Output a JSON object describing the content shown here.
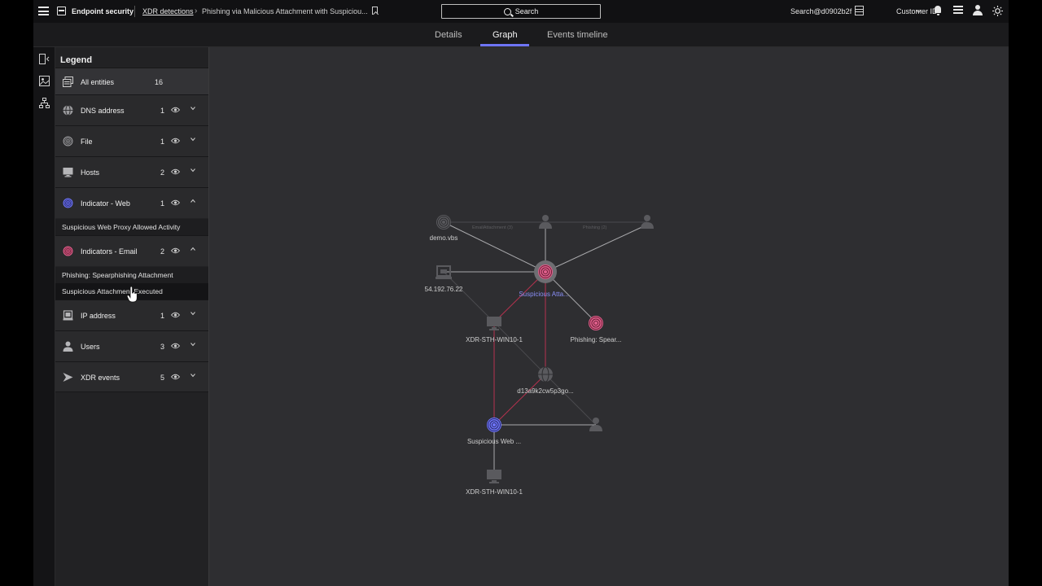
{
  "topbar": {
    "app_name": "Endpoint security",
    "breadcrumb_link": "XDR detections",
    "breadcrumb_current": "Phishing via Malicious Attachment with Suspiciou...",
    "search_label": "Search",
    "user_search": "Search@d0902b2f",
    "customer_label": "Customer ID"
  },
  "tabs": [
    {
      "label": "Details",
      "active": false
    },
    {
      "label": "Graph",
      "active": true
    },
    {
      "label": "Events timeline",
      "active": false
    }
  ],
  "accent_color": "#6e75f8",
  "legend": {
    "title": "Legend",
    "all_entities": {
      "label": "All entities",
      "count": "16"
    },
    "rows": [
      {
        "label": "DNS address",
        "count": "1",
        "icon": "globe-icon",
        "expanded": false
      },
      {
        "label": "File",
        "count": "1",
        "icon": "fingerprint-icon",
        "expanded": false
      },
      {
        "label": "Hosts",
        "count": "2",
        "icon": "monitor-icon",
        "expanded": false
      },
      {
        "label": "Indicator - Web",
        "count": "1",
        "icon": "web-indicator-icon",
        "expanded": true,
        "items": [
          "Suspicious Web Proxy Allowed Activity"
        ]
      },
      {
        "label": "Indicators - Email",
        "count": "2",
        "icon": "email-indicator-icon",
        "expanded": true,
        "items": [
          "Phishing: Spearphishing Attachment",
          "Suspicious Attachment Executed"
        ]
      },
      {
        "label": "IP address",
        "count": "1",
        "icon": "ip-icon",
        "expanded": false
      },
      {
        "label": "Users",
        "count": "3",
        "icon": "user-icon",
        "expanded": false
      },
      {
        "label": "XDR events",
        "count": "5",
        "icon": "xdr-event-icon",
        "expanded": false
      }
    ]
  },
  "graph": {
    "nodes": [
      {
        "id": "n1",
        "label": "demo.vbs",
        "type": "file"
      },
      {
        "id": "n2",
        "label": "",
        "type": "user"
      },
      {
        "id": "n3",
        "label": "",
        "type": "user"
      },
      {
        "id": "n4",
        "label": "54.192.76.22",
        "type": "ip"
      },
      {
        "id": "n5",
        "label": "Suspicious Atta...",
        "type": "email-indicator-selected"
      },
      {
        "id": "n6",
        "label": "XDR-STH-WIN10-1",
        "type": "host"
      },
      {
        "id": "n7",
        "label": "Phishing: Spear...",
        "type": "email-indicator"
      },
      {
        "id": "n8",
        "label": "d13a9k2cw5p3go...",
        "type": "dns"
      },
      {
        "id": "n9",
        "label": "Suspicious Web ...",
        "type": "web-indicator"
      },
      {
        "id": "n10",
        "label": "",
        "type": "user"
      },
      {
        "id": "n11",
        "label": "XDR-STH-WIN10-1",
        "type": "host"
      }
    ],
    "edge_labels": [
      "EmailAttachment (3)",
      "Phishing (2)"
    ],
    "colors": {
      "email": "#e0608c",
      "web": "#6e75f8",
      "neutral": "#5a5a5e",
      "edge": "#a8a8ab",
      "edge_red": "#b7324f"
    }
  }
}
